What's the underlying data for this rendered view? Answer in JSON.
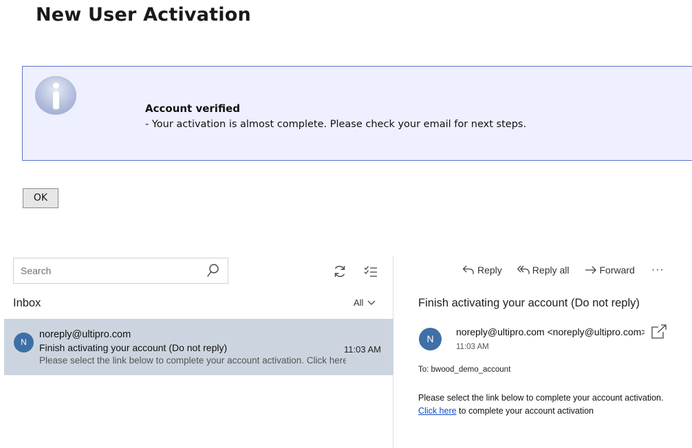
{
  "page": {
    "title": "New User Activation"
  },
  "notice": {
    "icon": "info-icon",
    "title": "Account verified",
    "message": "- Your activation is almost complete. Please check your email for next steps."
  },
  "ok_button": {
    "label": "OK"
  },
  "mail": {
    "search": {
      "placeholder": "Search"
    },
    "folder": "Inbox",
    "filter": "All",
    "message": {
      "avatar_initial": "N",
      "sender": "noreply@ultipro.com",
      "subject": "Finish activating your account (Do not reply)",
      "time": "11:03 AM",
      "preview": "Please select the link below to complete your account activation. Click here to complete your account activation"
    }
  },
  "reading": {
    "actions": {
      "reply": "Reply",
      "reply_all": "Reply all",
      "forward": "Forward",
      "more": "···"
    },
    "subject": "Finish activating your account (Do not reply)",
    "avatar_initial": "N",
    "from": "noreply@ultipro.com <noreply@ultipro.com>",
    "time": "11:03 AM",
    "to": "To: bwood_demo_account",
    "body_line1": "Please select the link below to complete your account activation.",
    "link_text": "Click here",
    "body_line2_rest": " to complete your account activation"
  },
  "colors": {
    "accent": "#3e6fa6",
    "selected_row": "#ccd5df",
    "notice_bg": "#eeefff",
    "notice_border": "#5a72c4",
    "link": "#0b4dc4"
  }
}
